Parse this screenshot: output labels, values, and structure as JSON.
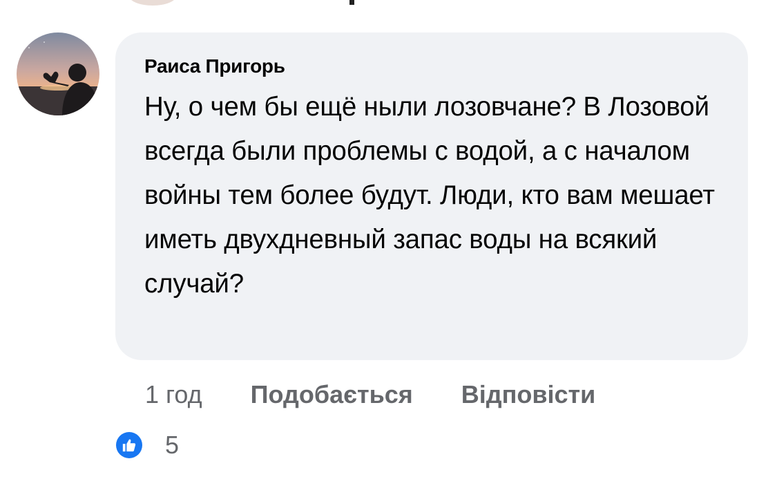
{
  "comment": {
    "author": "Раиса Пригорь",
    "text": "Ну, о чем бы ещё ныли лозовчане? В Лозовой всегда были проблемы с водой, а с началом войны тем более будут. Люди, кто вам мешает иметь двухдневный запас воды на всякий случай?",
    "avatar_icon": "profile-photo-heart-hands-sunset",
    "bubble_color": "#f0f2f5"
  },
  "actions": {
    "timestamp": "1 год",
    "like_label": "Подобається",
    "reply_label": "Відповісти"
  },
  "reactions": {
    "icon": "thumbs-up-icon",
    "icon_color": "#1877f2",
    "count": "5"
  }
}
